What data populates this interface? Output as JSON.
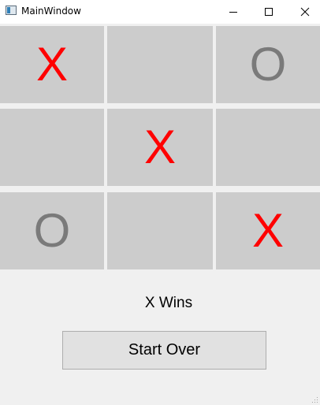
{
  "window": {
    "title": "MainWindow",
    "controls": {
      "minimize_icon": "minimize-icon",
      "maximize_icon": "maximize-icon",
      "close_icon": "close-icon"
    }
  },
  "board": {
    "cells": [
      "X",
      "",
      "O",
      "",
      "X",
      "",
      "O",
      "",
      "X"
    ],
    "colors": {
      "X": "#ff0000",
      "O": "#7a7a7a",
      "cell_background": "#cccccc"
    }
  },
  "status": {
    "text": "X Wins"
  },
  "actions": {
    "start_over_label": "Start Over"
  }
}
